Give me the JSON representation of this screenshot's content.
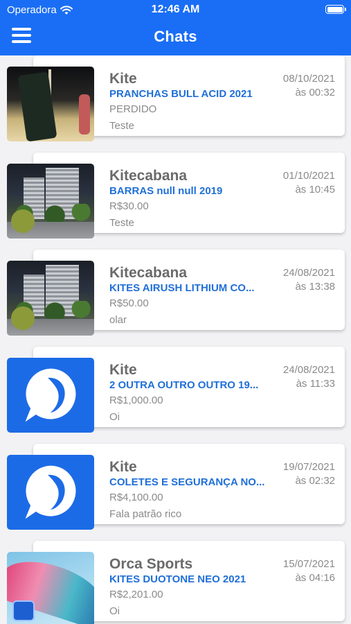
{
  "status_bar": {
    "carrier": "Operadora",
    "time": "12:46 AM"
  },
  "header": {
    "title": "Chats",
    "menu_icon": "hamburger-menu-icon"
  },
  "chats": [
    {
      "name": "Kite",
      "product": "PRANCHAS BULL ACID 2021",
      "price": "PERDIDO",
      "message": "Teste",
      "date": "08/10/2021",
      "time": "às 00:32",
      "thumbnail": "photo-night-street-bike"
    },
    {
      "name": "Kitecabana",
      "product": "BARRAS null null 2019",
      "price": "R$30.00",
      "message": "Teste",
      "date": "01/10/2021",
      "time": "às 10:45",
      "thumbnail": "photo-night-buildings"
    },
    {
      "name": "Kitecabana",
      "product": "KITES AIRUSH LITHIUM CO...",
      "price": "R$50.00",
      "message": "olar",
      "date": "24/08/2021",
      "time": "às 13:38",
      "thumbnail": "photo-night-buildings"
    },
    {
      "name": "Kite",
      "product": "2 OUTRA OUTRO OUTRO 19...",
      "price": "R$1,000.00",
      "message": "Oi",
      "date": "24/08/2021",
      "time": "às 11:33",
      "thumbnail": "app-logo-chat-bubble"
    },
    {
      "name": "Kite",
      "product": "COLETES E SEGURANÇA NO...",
      "price": "R$4,100.00",
      "message": "Fala patrão rico",
      "date": "19/07/2021",
      "time": "às 02:32",
      "thumbnail": "app-logo-chat-bubble"
    },
    {
      "name": "Orca Sports",
      "product": "KITES DUOTONE NEO 2021",
      "price": "R$2,201.00",
      "message": "Oi",
      "date": "15/07/2021",
      "time": "às 04:16",
      "thumbnail": "photo-kite-sail"
    }
  ],
  "colors": {
    "header_bg": "#1a6ef5",
    "product_text": "#1f6fd8",
    "name_text": "#6a6a6a",
    "muted_text": "#8a8a8a"
  }
}
